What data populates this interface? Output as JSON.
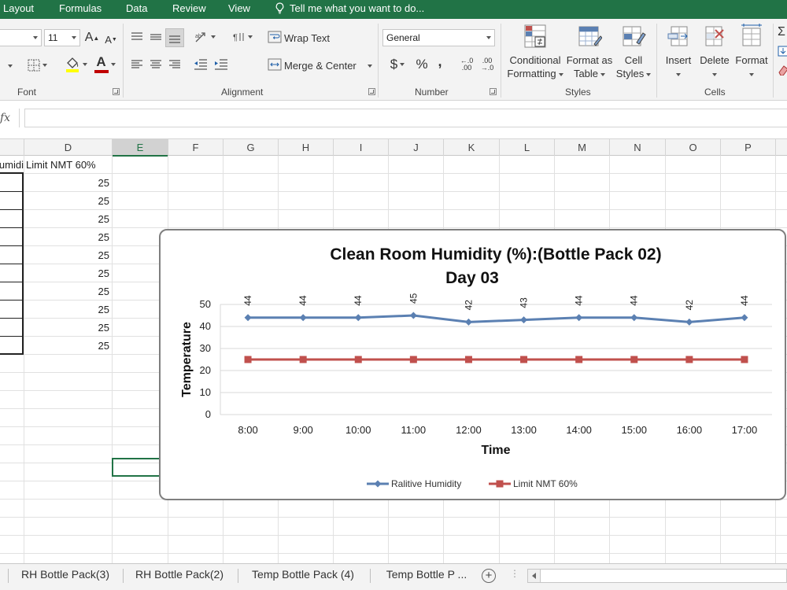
{
  "ribbon_tabs": [
    "Layout",
    "Formulas",
    "Data",
    "Review",
    "View"
  ],
  "tell_me": "Tell me what you want to do...",
  "font": {
    "size": "11",
    "group_label": "Font",
    "grow": "A",
    "shrink": "A",
    "font_color_letter": "A"
  },
  "alignment": {
    "wrap_text": "Wrap Text",
    "merge_center": "Merge & Center",
    "group_label": "Alignment"
  },
  "number": {
    "format": "General",
    "currency": "$",
    "percent": "%",
    "comma": ",",
    "inc_decimal_top": "←.0",
    "inc_decimal_bottom": ".00",
    "dec_decimal_top": ".00",
    "dec_decimal_bottom": "→.0",
    "group_label": "Number"
  },
  "styles": {
    "conditional": [
      "Conditional",
      "Formatting"
    ],
    "format_table": [
      "Format as",
      "Table"
    ],
    "cell_styles": [
      "Cell",
      "Styles"
    ],
    "group_label": "Styles"
  },
  "cells": {
    "insert": "Insert",
    "delete": "Delete",
    "format": "Format",
    "group_label": "Cells"
  },
  "formula_bar": {
    "fx": "fx",
    "value": ""
  },
  "columns": [
    "",
    "D",
    "E",
    "F",
    "G",
    "H",
    "I",
    "J",
    "K",
    "L",
    "M",
    "N",
    "O",
    "P"
  ],
  "selected_column": "E",
  "sheet": {
    "c_header": "umidi",
    "d_header": "Limit NMT 60%",
    "d_values": [
      "25",
      "25",
      "25",
      "25",
      "25",
      "25",
      "25",
      "25",
      "25",
      "25"
    ]
  },
  "chart_data": {
    "type": "line",
    "title": "Clean Room Humidity (%):(Bottle Pack 02)",
    "subtitle": "Day 03",
    "xlabel": "Time",
    "ylabel": "Temperature",
    "categories": [
      "8:00",
      "9:00",
      "10:00",
      "11:00",
      "12:00",
      "13:00",
      "14:00",
      "15:00",
      "16:00",
      "17:00"
    ],
    "ylim": [
      0,
      50
    ],
    "yticks": [
      "0",
      "10",
      "20",
      "30",
      "40",
      "50"
    ],
    "grid": true,
    "legend_position": "bottom",
    "series": [
      {
        "name": "Ralitive Humidity",
        "values": [
          44,
          44,
          44,
          45,
          42,
          43,
          44,
          44,
          42,
          44
        ],
        "color": "#5b80b2",
        "marker": "diamond",
        "labels": [
          "44",
          "44",
          "44",
          "45",
          "42",
          "43",
          "44",
          "44",
          "42",
          "44"
        ]
      },
      {
        "name": "Limit NMT 60%",
        "values": [
          25,
          25,
          25,
          25,
          25,
          25,
          25,
          25,
          25,
          25
        ],
        "color": "#c0504d",
        "marker": "square"
      }
    ]
  },
  "sheet_tabs": [
    "RH Bottle Pack(3)",
    "RH Bottle Pack(2)",
    "Temp Bottle Pack (4)",
    "Temp Bottle P ..."
  ],
  "colors": {
    "excel_green": "#217346",
    "humidity_line": "#5b80b2",
    "limit_line": "#c0504d",
    "fill_yellow": "#ffff00",
    "font_red": "#c00000"
  }
}
